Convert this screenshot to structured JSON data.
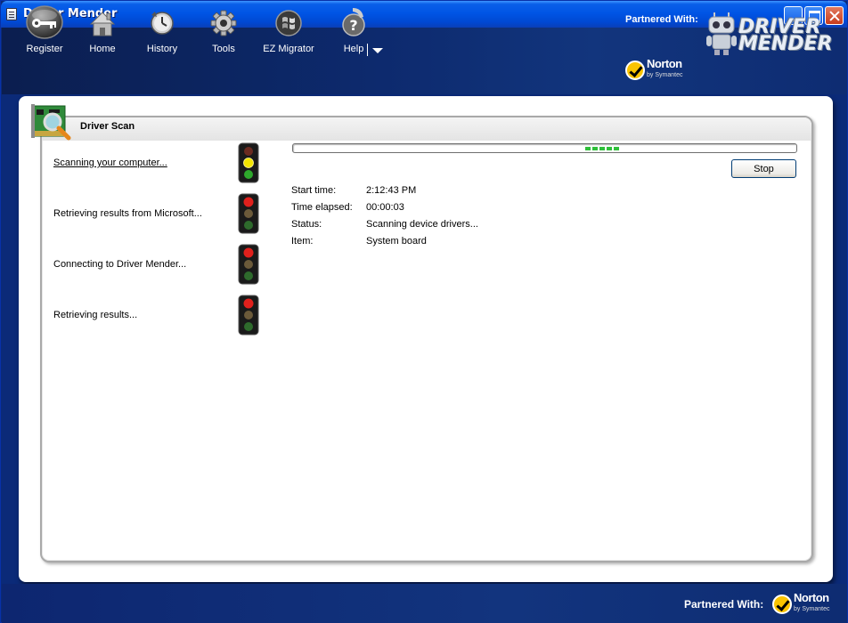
{
  "window": {
    "title": "Driver Mender"
  },
  "toolbar": {
    "items": [
      {
        "id": "register",
        "label": "Register"
      },
      {
        "id": "home",
        "label": "Home"
      },
      {
        "id": "history",
        "label": "History"
      },
      {
        "id": "tools",
        "label": "Tools"
      },
      {
        "id": "ez-migrator",
        "label": "EZ Migrator"
      },
      {
        "id": "help",
        "label": "Help"
      }
    ]
  },
  "branding": {
    "partner_label": "Partnered With:",
    "norton_name": "Norton",
    "norton_sub": "by Symantec",
    "logo_line1": "DRIVER",
    "logo_line2": "MENDER"
  },
  "scan": {
    "title": "Driver Scan",
    "steps": [
      {
        "label": "Scanning your computer...",
        "state": "active"
      },
      {
        "label": "Retrieving results from Microsoft...",
        "state": "pending"
      },
      {
        "label": "Connecting to Driver Mender...",
        "state": "pending"
      },
      {
        "label": "Retrieving results...",
        "state": "pending"
      }
    ],
    "progress_fraction_start": 0.58,
    "progress_fraction_end": 0.65,
    "stop_label": "Stop",
    "info": {
      "start_time_label": "Start time:",
      "start_time": "2:12:43 PM",
      "elapsed_label": "Time elapsed:",
      "elapsed": "00:00:03",
      "status_label": "Status:",
      "status": "Scanning device drivers...",
      "item_label": "Item:",
      "item": "System board"
    }
  },
  "footer": {
    "partner_label": "Partnered With:"
  },
  "colors": {
    "title_bar": "#0055e5",
    "header_bg": "#0d2a6e",
    "progress_green": "#2fbf3a",
    "light_red": "#e0201c",
    "light_yellow": "#f2e400",
    "light_green": "#2ea82c",
    "light_off": "#6b5a3a"
  }
}
